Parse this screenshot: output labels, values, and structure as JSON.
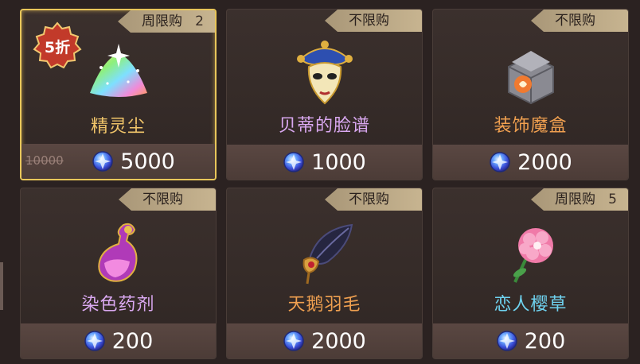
{
  "colors": {
    "name_gold": "#f2c66a",
    "name_purple": "#d9a8f0",
    "name_orange": "#f0a050",
    "name_cyan": "#6fd3f0",
    "selected_border": "#e8c65a",
    "tag_bg": "#c3b08c"
  },
  "discount_badge": "5折",
  "items": [
    {
      "name": "精灵尘",
      "tag": "周限购",
      "tag_count": "2",
      "old_price": "10000",
      "price": "5000",
      "icon": "sparkle-dust-icon",
      "name_color": "gold"
    },
    {
      "name": "贝蒂的脸谱",
      "tag": "不限购",
      "tag_count": "",
      "price": "1000",
      "icon": "masquerade-mask-icon",
      "name_color": "purple"
    },
    {
      "name": "装饰魔盒",
      "tag": "不限购",
      "tag_count": "",
      "price": "2000",
      "icon": "magic-box-icon",
      "name_color": "orange"
    },
    {
      "name": "染色药剂",
      "tag": "不限购",
      "tag_count": "",
      "price": "200",
      "icon": "dye-potion-icon",
      "name_color": "purple"
    },
    {
      "name": "天鹅羽毛",
      "tag": "不限购",
      "tag_count": "",
      "price": "2000",
      "icon": "swan-feather-icon",
      "name_color": "orange"
    },
    {
      "name": "恋人樱草",
      "tag": "周限购",
      "tag_count": "5",
      "price": "200",
      "icon": "primrose-flower-icon",
      "name_color": "cyan"
    }
  ]
}
